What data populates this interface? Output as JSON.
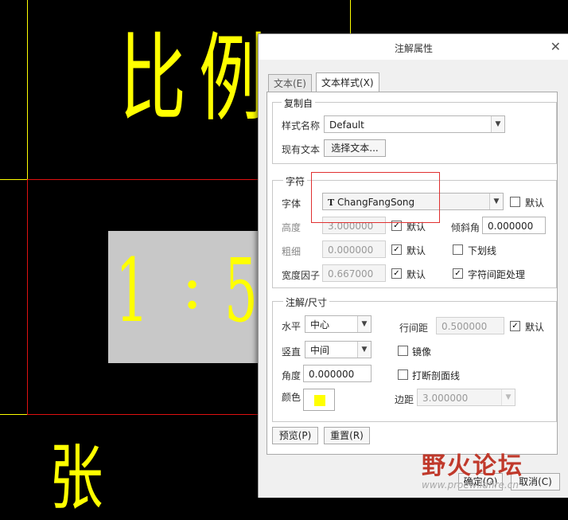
{
  "canvas": {
    "char_top": "比",
    "char_top2": "例",
    "char_ratio1": "1",
    "char_ratio_colon": ":",
    "char_ratio2": "5",
    "char_bottom": "张"
  },
  "dialog": {
    "title": "注解属性",
    "tabs": [
      {
        "label": "文本(E)"
      },
      {
        "label": "文本样式(X)"
      }
    ],
    "copy_from": {
      "group_label": "复制自",
      "style_name_label": "样式名称",
      "style_name_value": "Default",
      "existing_text_label": "现有文本",
      "select_text_button": "选择文本..."
    },
    "character": {
      "group_label": "字符",
      "font_label": "字体",
      "font_value": "ChangFangSong",
      "font_default_label": "默认",
      "height_label": "高度",
      "height_value": "3.000000",
      "height_default_label": "默认",
      "slant_label": "倾斜角",
      "slant_value": "0.000000",
      "thickness_label": "粗细",
      "thickness_value": "0.000000",
      "thickness_default_label": "默认",
      "underline_label": "下划线",
      "width_factor_label": "宽度因子",
      "width_factor_value": "0.667000",
      "width_factor_default_label": "默认",
      "kerning_label": "字符间距处理"
    },
    "note_dim": {
      "group_label": "注解/尺寸",
      "horizontal_label": "水平",
      "horizontal_value": "中心",
      "line_spacing_label": "行间距",
      "line_spacing_value": "0.500000",
      "line_spacing_default_label": "默认",
      "vertical_label": "竖直",
      "vertical_value": "中间",
      "mirror_label": "镜像",
      "angle_label": "角度",
      "angle_value": "0.000000",
      "break_hatch_label": "打断剖面线",
      "color_label": "颜色",
      "margin_label": "边距",
      "margin_value": "3.000000"
    },
    "buttons": {
      "preview": "预览(P)",
      "reset": "重置(R)",
      "ok": "确定(O)",
      "cancel": "取消(C)"
    }
  },
  "colors": {
    "canvas_yellow": "#ffff00",
    "canvas_red": "#e01010",
    "swatch_yellow": "#ffff00",
    "highlight_red": "#e03030"
  },
  "watermark": {
    "main": "野火论坛",
    "sub": "www.proewildfire.cn"
  }
}
